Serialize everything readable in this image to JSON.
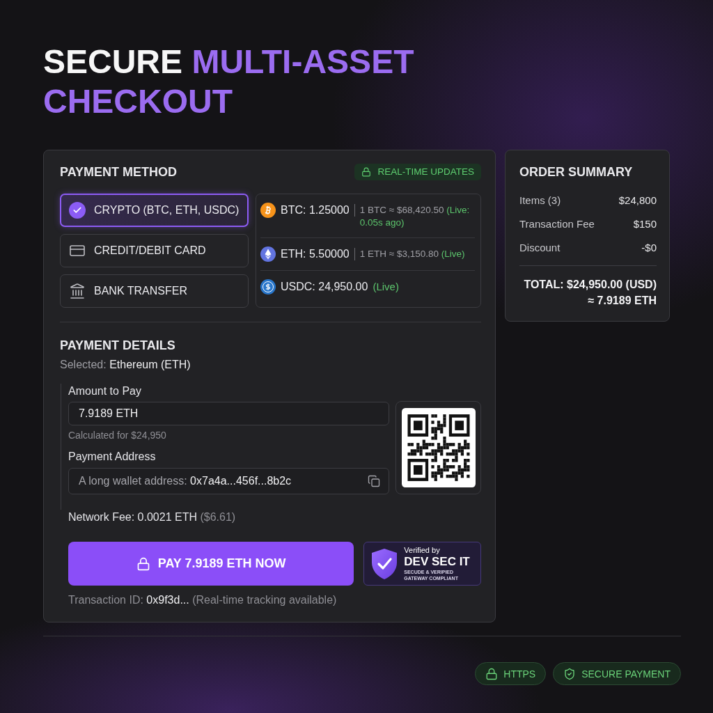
{
  "title": {
    "lead": "SECURE",
    "accent": "MULTI-ASSET CHECKOUT"
  },
  "payment_method": {
    "heading": "PAYMENT METHOD",
    "live_badge": "REAL-TIME UPDATES",
    "methods": [
      {
        "label": "CRYPTO (BTC, ETH, USDC)",
        "selected": true
      },
      {
        "label": "CREDIT/DEBIT CARD",
        "selected": false
      },
      {
        "label": "BANK TRANSFER",
        "selected": false
      }
    ],
    "assets": [
      {
        "kind": "btc",
        "amount": "BTC: 1.25000",
        "rate": "1 BTC ≈ $68,420.50",
        "live": "(Live: 0.05s ago)"
      },
      {
        "kind": "eth",
        "amount": "ETH: 5.50000",
        "rate": "1 ETH ≈ $3,150.80",
        "live": "(Live)"
      },
      {
        "kind": "usdc",
        "amount": "USDC: 24,950.00",
        "live": "(Live)"
      }
    ]
  },
  "payment_details": {
    "heading": "PAYMENT DETAILS",
    "selected": {
      "label": "Selected:",
      "value": "Ethereum (ETH)"
    },
    "amount": {
      "label": "Amount to Pay",
      "value": "7.9189 ETH",
      "hint": "Calculated for $24,950"
    },
    "address": {
      "label": "Payment Address",
      "prefix": "A long wallet address:",
      "value": "0x7a4a...456f...8b2c"
    },
    "network_fee": {
      "label": "Network Fee: 0.0021 ETH",
      "usd": "($6.61)"
    },
    "pay_button": "PAY 7.9189 ETH NOW",
    "verified": {
      "caption": "Verified by",
      "name": "DEV SEC IT",
      "note": "SECUDE & VERIPIED GATEWAY COMPLIANT"
    },
    "transaction": {
      "label": "Transaction ID:",
      "id": "0x9f3d...",
      "note": "(Real-time tracking available)"
    }
  },
  "order_summary": {
    "heading": "ORDER SUMMARY",
    "rows": [
      {
        "label": "Items (3)",
        "value": "$24,800"
      },
      {
        "label": "Transaction Fee",
        "value": "$150"
      },
      {
        "label": "Discount",
        "value": "-$0"
      }
    ],
    "total": "TOTAL: $24,950.00 (USD)",
    "total_converted": "≈ 7.9189 ETH"
  },
  "footer_badges": [
    {
      "kind": "lock",
      "label": "HTTPS"
    },
    {
      "kind": "shield",
      "label": "SECURE PAYMENT"
    }
  ]
}
